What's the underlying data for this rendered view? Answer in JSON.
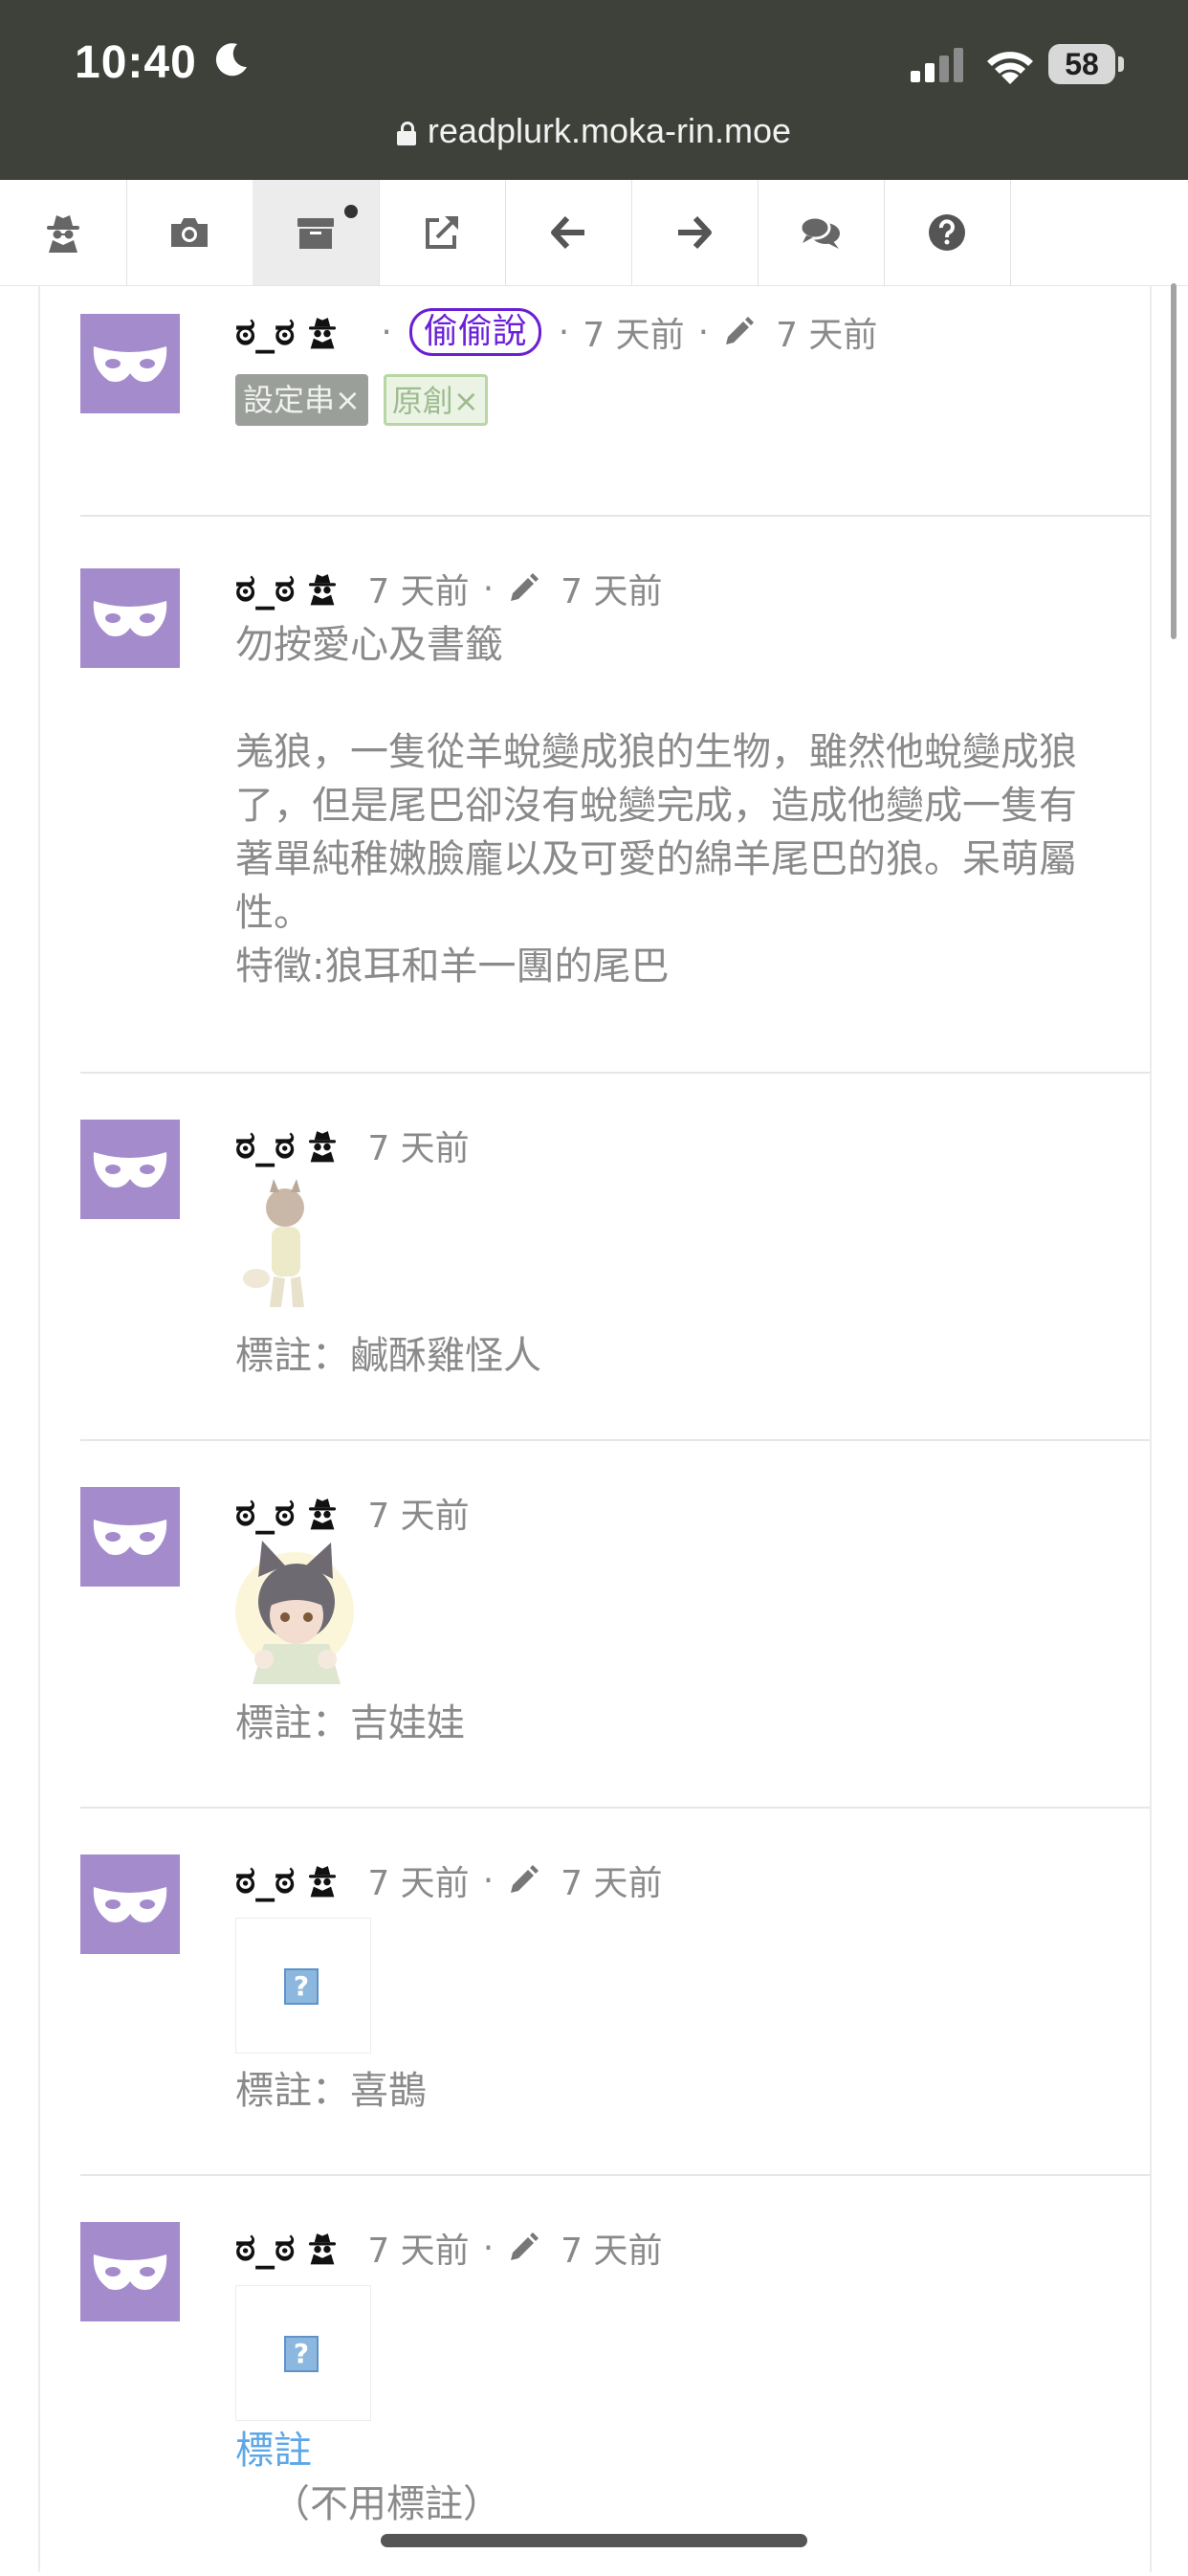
{
  "status": {
    "time": "10:40",
    "battery": "58",
    "url": "readplurk.moka-rin.moe"
  },
  "toolbar": {
    "items": [
      {
        "icon": "spy-icon"
      },
      {
        "icon": "camera-icon"
      },
      {
        "icon": "archive-icon",
        "active": true,
        "notification": true
      },
      {
        "icon": "external-link-icon"
      },
      {
        "icon": "arrow-left-icon"
      },
      {
        "icon": "arrow-right-icon"
      },
      {
        "icon": "comments-icon"
      },
      {
        "icon": "help-icon"
      }
    ]
  },
  "colors": {
    "avatar": "#a48bcc",
    "badge": "#6a1fd6",
    "link": "#5da7e6"
  },
  "posts": [
    {
      "user": "ಠ_ಠ",
      "badge": "偷偷說",
      "posted": "7 天前",
      "edited": "7 天前",
      "tags": [
        "設定串×",
        "原創×"
      ]
    },
    {
      "user": "ಠ_ಠ",
      "posted": "7 天前",
      "edited": "7 天前",
      "paragraphs": [
        "勿按愛心及書籤",
        "",
        "羗狼，一隻從羊蛻變成狼的生物，雖然他蛻變成狼了，但是尾巴卻沒有蛻變完成，造成他變成一隻有著單純稚嫩臉龐以及可愛的綿羊尾巴的狼。呆萌屬性。",
        "特徵:狼耳和羊一團的尾巴"
      ]
    },
    {
      "user": "ಠ_ಠ",
      "posted": "7 天前",
      "caption": "標註：鹹酥雞怪人"
    },
    {
      "user": "ಠ_ಠ",
      "posted": "7 天前",
      "caption": "標註：吉娃娃"
    },
    {
      "user": "ಠ_ಠ",
      "posted": "7 天前",
      "edited": "7 天前",
      "caption": "標註：喜鵲"
    },
    {
      "user": "ಠ_ಠ",
      "posted": "7 天前",
      "edited": "7 天前",
      "link": "標註",
      "note": "（不用標註）"
    }
  ]
}
